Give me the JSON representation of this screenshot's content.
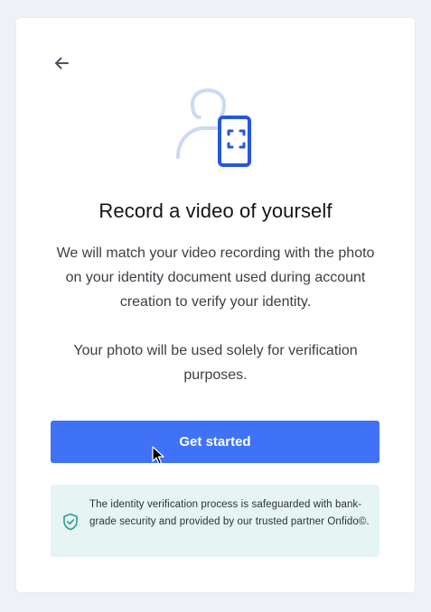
{
  "screen": {
    "title": "Record a video of yourself",
    "description_1": "We will match your video recording with the photo on your identity document used during account creation to verify your identity.",
    "description_2": "Your photo will be used solely for verification purposes.",
    "primary_button_label": "Get started",
    "security_notice": "The identity verification process is safeguarded with bank-grade security and provided by our trusted partner Onfido©."
  },
  "icons": {
    "back": "arrow-left-icon",
    "hero": "person-phone-icon",
    "notice": "shield-check-icon",
    "cursor": "mouse-pointer-icon"
  },
  "colors": {
    "page_background": "#eef1f6",
    "card_background": "#ffffff",
    "primary": "#3f72f6",
    "hero_light": "#c9daf3",
    "hero_dark": "#2557e0",
    "notice_background": "#e6f4f3",
    "notice_icon": "#2a9d8f",
    "title": "#111418",
    "body_text": "#3b3f45"
  }
}
